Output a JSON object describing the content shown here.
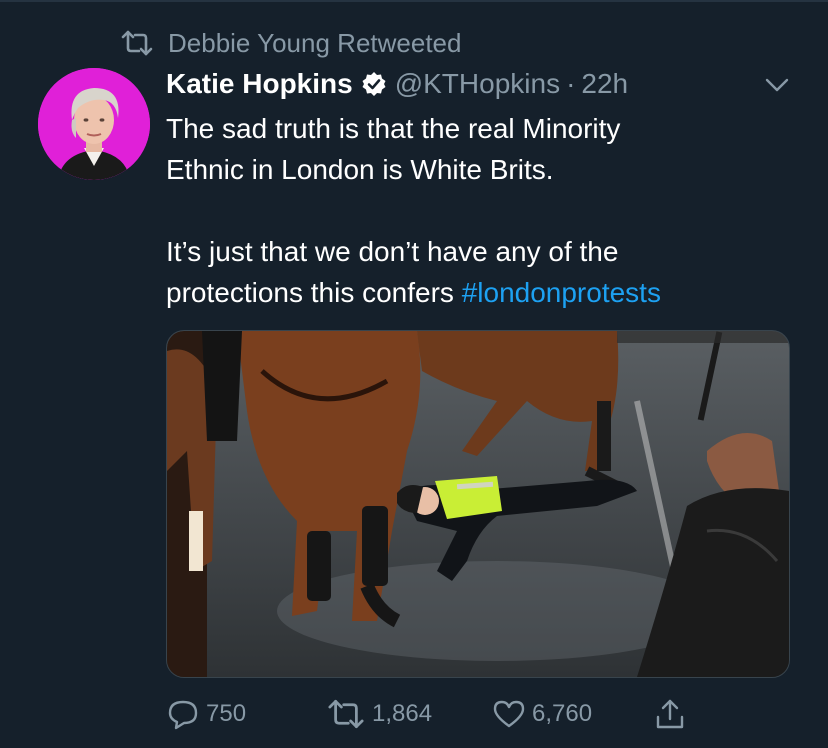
{
  "retweet_context": {
    "icon": "retweet-icon",
    "text": "Debbie Young Retweeted"
  },
  "author": {
    "name": "Katie Hopkins",
    "verified_icon": "verified-badge-icon",
    "handle": "@KTHopkins",
    "separator": "·",
    "time": "22h"
  },
  "tweet": {
    "line1": "The sad truth is that the real  Minority",
    "line2": "Ethnic in London is White Brits.",
    "line3": "It’s just that we don’t have any of the",
    "line4_text": "protections this confers ",
    "hashtag": "#londonprotests"
  },
  "actions": {
    "reply_count": "750",
    "retweet_count": "1,864",
    "like_count": "6,760",
    "share_icon": "share-icon"
  },
  "colors": {
    "background": "#15202b",
    "muted": "#8899a6",
    "link": "#1da1f2",
    "avatar_ring": "#e020d8"
  }
}
